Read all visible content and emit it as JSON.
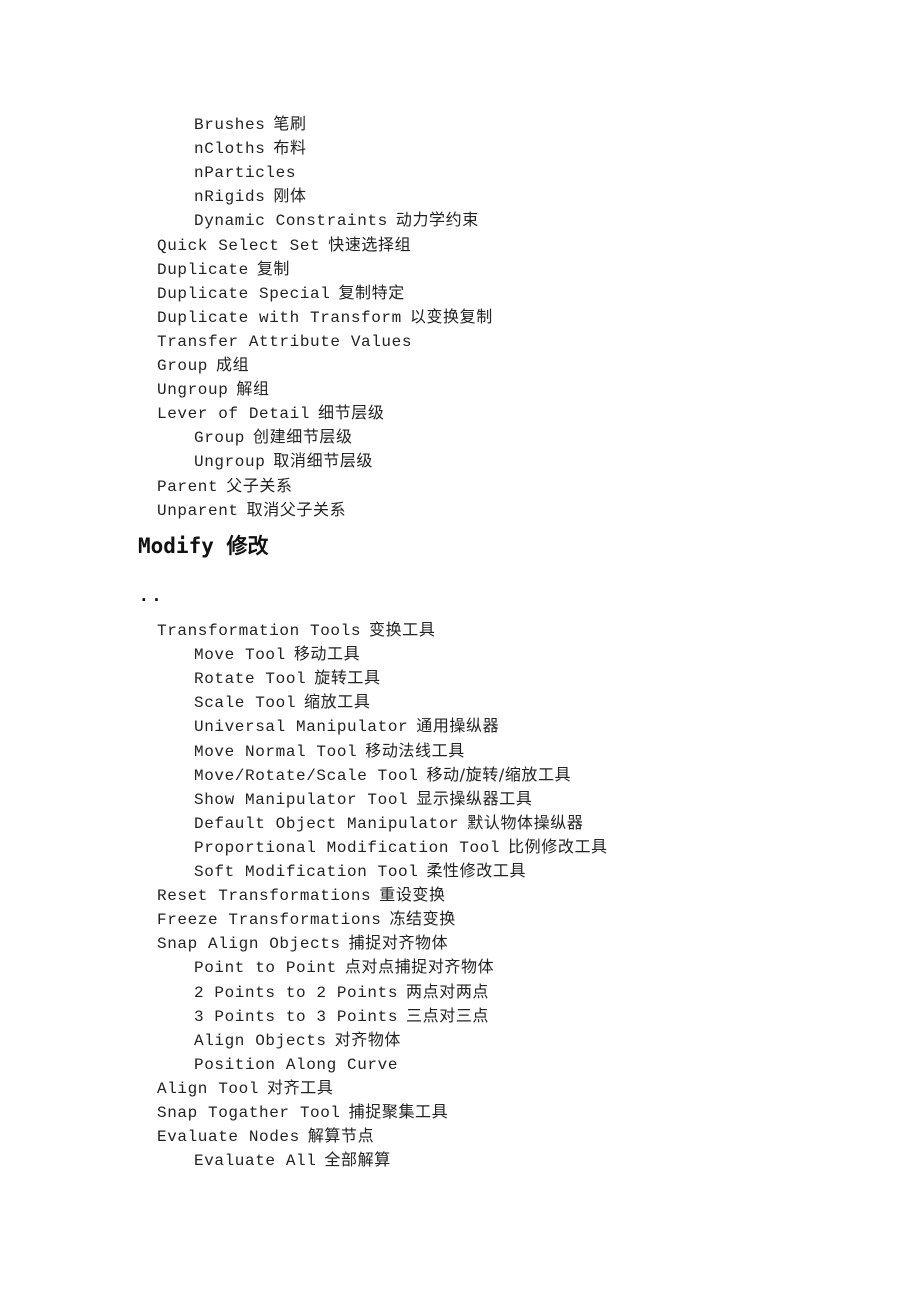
{
  "section_edit_tail": [
    {
      "level": 2,
      "en": "Brushes",
      "zh": "笔刷"
    },
    {
      "level": 2,
      "en": "nCloths",
      "zh": "布料"
    },
    {
      "level": 2,
      "en": "nParticles",
      "zh": ""
    },
    {
      "level": 2,
      "en": "nRigids",
      "zh": "刚体"
    },
    {
      "level": 2,
      "en": "Dynamic Constraints",
      "zh": "动力学约束"
    },
    {
      "level": 1,
      "en": "Quick Select Set",
      "zh": "快速选择组"
    },
    {
      "level": 1,
      "en": "Duplicate",
      "zh": "复制"
    },
    {
      "level": 1,
      "en": "Duplicate Special",
      "zh": "复制特定"
    },
    {
      "level": 1,
      "en": "Duplicate with Transform",
      "zh": "以变换复制"
    },
    {
      "level": 1,
      "en": "Transfer Attribute Values",
      "zh": ""
    },
    {
      "level": 1,
      "en": "Group",
      "zh": "成组"
    },
    {
      "level": 1,
      "en": "Ungroup",
      "zh": "解组"
    },
    {
      "level": 1,
      "en": "Lever of Detail",
      "zh": "细节层级"
    },
    {
      "level": 2,
      "en": "Group",
      "zh": "创建细节层级"
    },
    {
      "level": 2,
      "en": "Ungroup",
      "zh": "取消细节层级"
    },
    {
      "level": 1,
      "en": "Parent",
      "zh": "父子关系"
    },
    {
      "level": 1,
      "en": "Unparent",
      "zh": "取消父子关系"
    }
  ],
  "modify_heading": "Modify 修改",
  "dots": "..",
  "section_modify": [
    {
      "level": 1,
      "en": "Transformation Tools",
      "zh": "变换工具"
    },
    {
      "level": 2,
      "en": "Move Tool",
      "zh": "移动工具"
    },
    {
      "level": 2,
      "en": "Rotate Tool",
      "zh": "旋转工具"
    },
    {
      "level": 2,
      "en": "Scale Tool",
      "zh": "缩放工具"
    },
    {
      "level": 2,
      "en": "Universal Manipulator",
      "zh": "通用操纵器"
    },
    {
      "level": 2,
      "en": "Move Normal Tool",
      "zh": "移动法线工具"
    },
    {
      "level": 2,
      "en": "Move/Rotate/Scale Tool",
      "zh": "移动/旋转/缩放工具"
    },
    {
      "level": 2,
      "en": "Show Manipulator Tool",
      "zh": "显示操纵器工具"
    },
    {
      "level": 2,
      "en": "Default Object Manipulator",
      "zh": "默认物体操纵器"
    },
    {
      "level": 2,
      "en": "Proportional Modification Tool",
      "zh": "比例修改工具"
    },
    {
      "level": 2,
      "en": "Soft Modification Tool",
      "zh": "柔性修改工具"
    },
    {
      "level": 1,
      "en": "Reset Transformations",
      "zh": "重设变换"
    },
    {
      "level": 1,
      "en": "Freeze Transformations",
      "zh": "冻结变换"
    },
    {
      "level": 1,
      "en": "Snap Align Objects",
      "zh": "捕捉对齐物体"
    },
    {
      "level": 2,
      "en": "Point to Point",
      "zh": "点对点捕捉对齐物体"
    },
    {
      "level": 2,
      "en": "2 Points to 2 Points",
      "zh": "两点对两点"
    },
    {
      "level": 2,
      "en": "3 Points to 3 Points",
      "zh": "三点对三点"
    },
    {
      "level": 2,
      "en": "Align Objects",
      "zh": "对齐物体"
    },
    {
      "level": 2,
      "en": "Position Along Curve",
      "zh": ""
    },
    {
      "level": 1,
      "en": "Align Tool",
      "zh": "对齐工具"
    },
    {
      "level": 1,
      "en": "Snap Togather Tool",
      "zh": "捕捉聚集工具"
    },
    {
      "level": 1,
      "en": "Evaluate Nodes",
      "zh": "解算节点"
    },
    {
      "level": 2,
      "en": "Evaluate All",
      "zh": "全部解算"
    }
  ]
}
